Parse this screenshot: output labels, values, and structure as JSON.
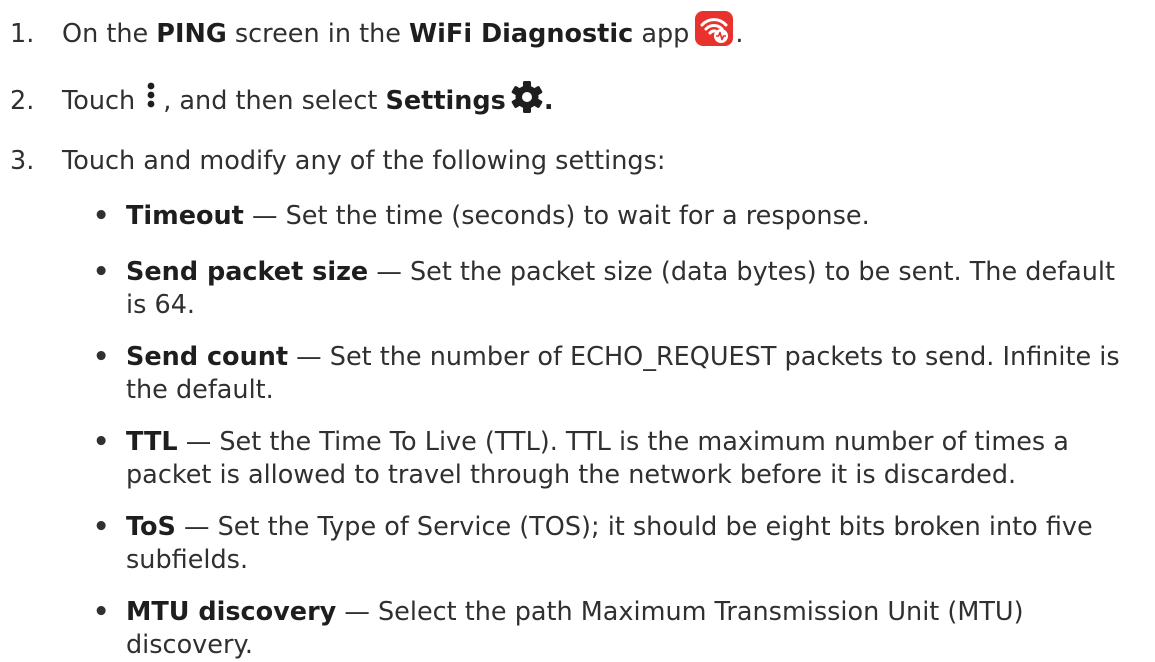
{
  "steps": [
    {
      "num": "1.",
      "pre": "On the ",
      "b1": "PING",
      "mid": " screen in the ",
      "b2": "WiFi Diagnostic",
      "post": " app",
      "end": "."
    },
    {
      "num": "2.",
      "pre": "Touch",
      "mid": ", and then select ",
      "b1": "Settings",
      "end": "."
    },
    {
      "num": "3.",
      "text": "Touch and modify any of the following settings:"
    }
  ],
  "bullet_symbol": "•",
  "dash": " — ",
  "settings": [
    {
      "name": "Timeout",
      "desc": "Set the time (seconds) to wait for a response."
    },
    {
      "name": "Send packet size",
      "desc": "Set the packet size (data bytes) to be sent. The default is 64."
    },
    {
      "name": "Send count",
      "desc": "Set the number of ECHO_REQUEST packets to send. Infinite is the default."
    },
    {
      "name": "TTL",
      "desc": "Set the Time To Live (TTL). TTL is the maximum number of times a packet is allowed to travel through the network before it is discarded."
    },
    {
      "name": "ToS",
      "desc": "Set the Type of Service (TOS); it should be eight bits broken into five subfields."
    },
    {
      "name": "MTU discovery",
      "desc": "Select the path Maximum Transmission Unit (MTU) discovery."
    }
  ],
  "icons": {
    "app_icon": "wifi-diagnostic-app-icon",
    "menu_icon": "kebab-menu-icon",
    "settings_icon": "gear-icon",
    "app_icon_color": "#e8322d"
  }
}
